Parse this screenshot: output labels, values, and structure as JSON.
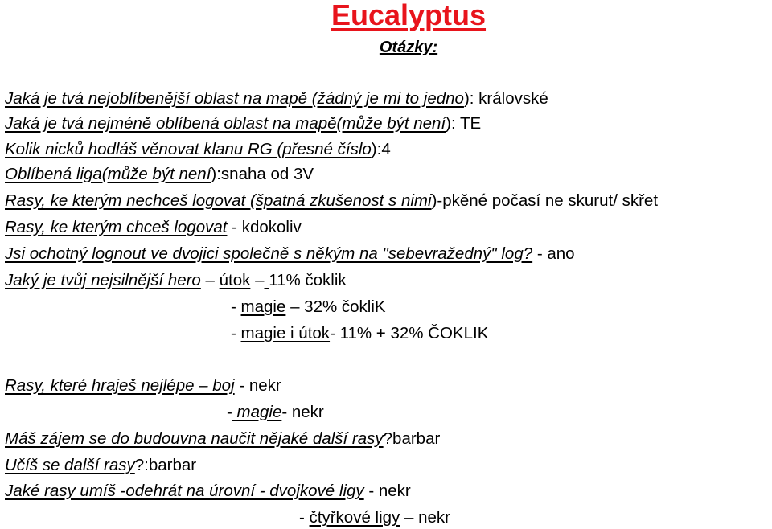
{
  "title": "Eucalyptus",
  "subtitle": "Otázky:",
  "lines": [
    {
      "q": "Jaká je tvá nejoblíbenější oblast na mapě (žádný je mi to jedno",
      "a": "): královské"
    },
    {
      "q": "Jaká je tvá nejméně oblíbená oblast na mapě(může být není",
      "a": "): TE"
    },
    {
      "q": "Kolik nicků hodláš věnovat klanu RG (přesné číslo",
      "a": "):4"
    },
    {
      "q": "Oblíbená liga(může být není",
      "a": "):snaha od 3V"
    },
    {
      "q": "Rasy, ke kterým nechceš logovat (špatná zkušenost s nimi",
      "a": ")-pkěné počasí ne skurut/ skřet"
    },
    {
      "q": "Rasy, ke kterým chceš logovat",
      "a": " - kdokoliv"
    },
    {
      "q": "Jsi ochotný lognout ve dvojici společně s někým na \"sebevražedný\" log?",
      "a": " - ano"
    },
    {
      "q": "Jaký je tvůj nejsilnější hero",
      "a1": " – ",
      "u1": "útok",
      "a2": " –",
      "u2": " ",
      "a3": "11% čoklik"
    },
    {
      "pre": "- ",
      "u": "magie",
      "a": " – 32% čokliK"
    },
    {
      "pre": "- ",
      "u": "magie i útok",
      "a": "- 11% + 32% ČOKLIK"
    },
    {
      "q": "Rasy, které hraješ nejlépe – boj",
      "a": " - nekr"
    },
    {
      "pre": "-",
      "q": " magie",
      "a": "- nekr"
    },
    {
      "q": "Máš zájem se do budouvna naučit nějaké další rasy",
      "a": "?barbar"
    },
    {
      "q": "Učíš se další rasy",
      "a": "?:barbar"
    },
    {
      "q": "Jaké rasy umíš -odehrát na úrovní - dvojkové ligy",
      "a": " - nekr"
    },
    {
      "pre": "- ",
      "u": "čtyřkové ligy",
      "a": " – nekr"
    }
  ]
}
